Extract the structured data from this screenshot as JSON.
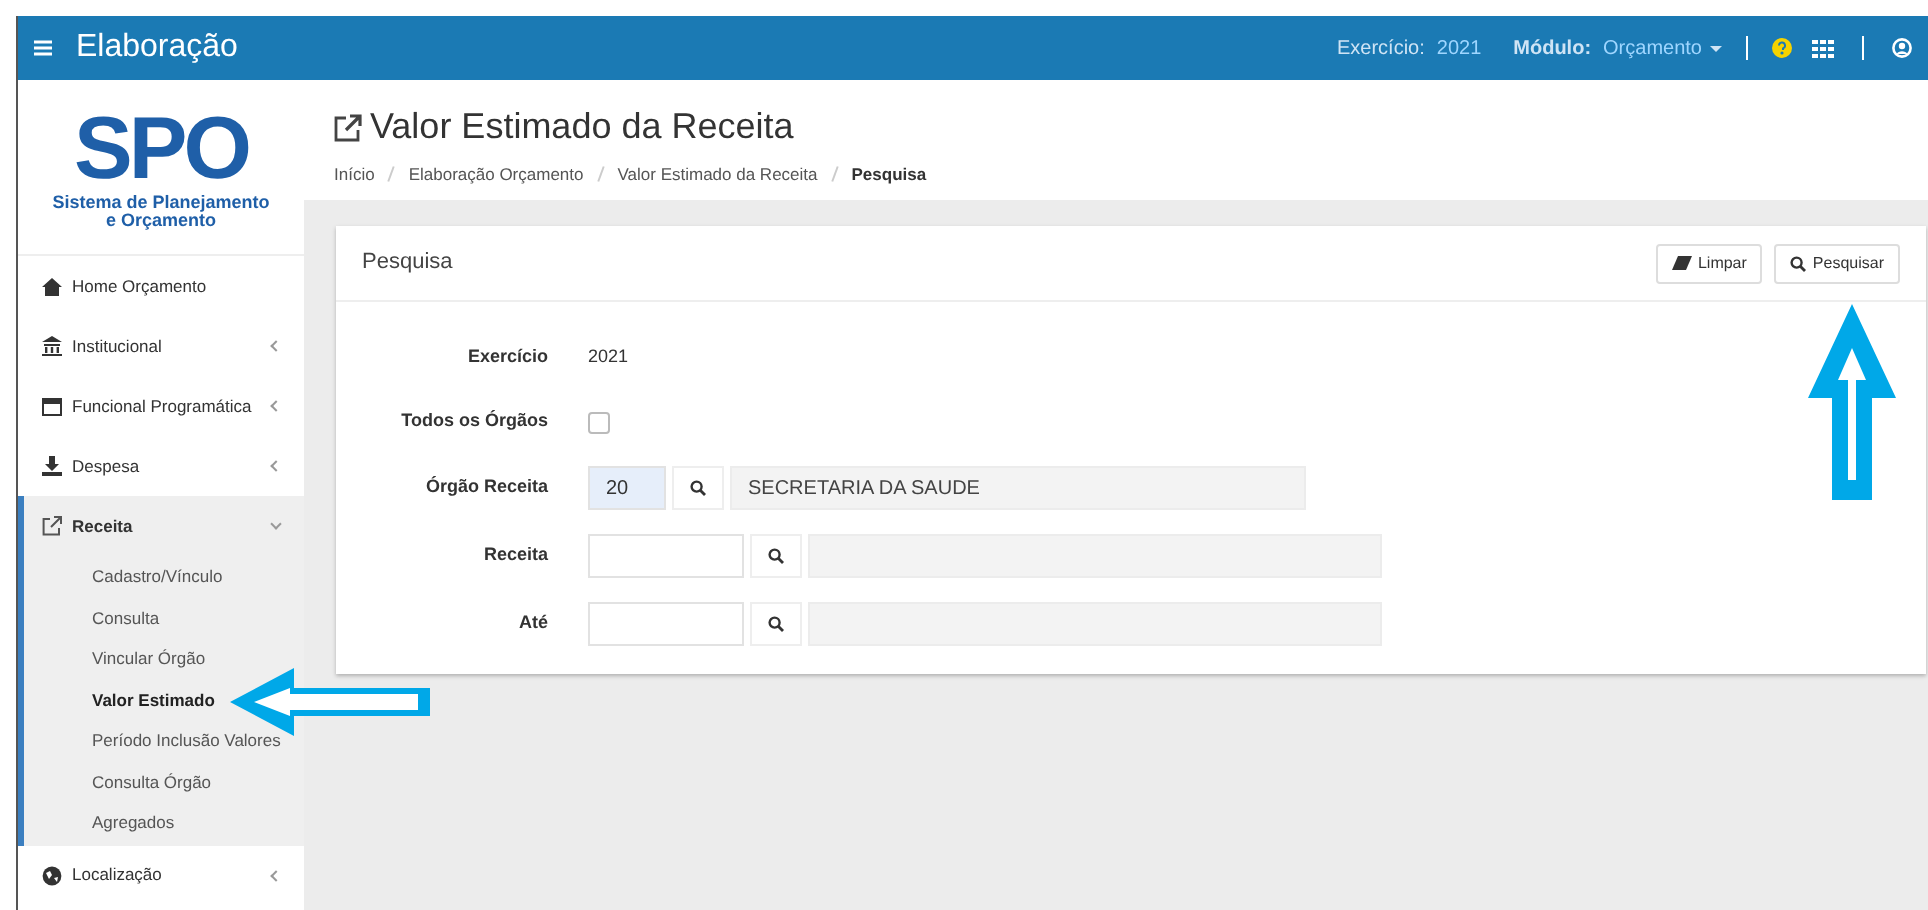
{
  "header": {
    "title": "Elaboração",
    "exercise_label": "Exercício:",
    "exercise_value": "2021",
    "module_label": "Módulo:",
    "module_value": "Orçamento"
  },
  "logo": {
    "text": "SPO",
    "subtitle": "Sistema de Planejamento e Orçamento"
  },
  "sidebar": {
    "items": [
      {
        "label": "Home Orçamento",
        "expandable": false,
        "expanded": false
      },
      {
        "label": "Institucional",
        "expandable": true,
        "expanded": false
      },
      {
        "label": "Funcional Programática",
        "expandable": true,
        "expanded": false
      },
      {
        "label": "Despesa",
        "expandable": true,
        "expanded": false
      },
      {
        "label": "Receita",
        "expandable": true,
        "expanded": true,
        "children": [
          {
            "label": "Cadastro/Vínculo",
            "selected": false
          },
          {
            "label": "Consulta",
            "selected": false
          },
          {
            "label": "Vincular Órgão",
            "selected": false
          },
          {
            "label": "Valor Estimado",
            "selected": true
          },
          {
            "label": "Período Inclusão Valores",
            "selected": false
          },
          {
            "label": "Consulta Órgão",
            "selected": false
          },
          {
            "label": "Agregados",
            "selected": false
          }
        ]
      },
      {
        "label": "Localização",
        "expandable": true,
        "expanded": false
      }
    ]
  },
  "page": {
    "title": "Valor Estimado da Receita",
    "breadcrumb": [
      "Início",
      "Elaboração Orçamento",
      "Valor Estimado da Receita",
      "Pesquisa"
    ]
  },
  "panel": {
    "title": "Pesquisa",
    "buttons": [
      {
        "label": "Limpar",
        "kind": "clear"
      },
      {
        "label": "Pesquisar",
        "kind": "search"
      }
    ],
    "fields": [
      {
        "label": "Exercício",
        "kind": "text",
        "value": "2021"
      },
      {
        "label": "Todos os Órgãos",
        "kind": "checkbox",
        "checked": false
      },
      {
        "label": "Órgão Receita",
        "kind": "lookup",
        "code": "20",
        "description": "SECRETARIA DA SAUDE"
      },
      {
        "label": "Receita",
        "kind": "lookup"
      },
      {
        "label": "Até",
        "kind": "lookup"
      }
    ]
  }
}
